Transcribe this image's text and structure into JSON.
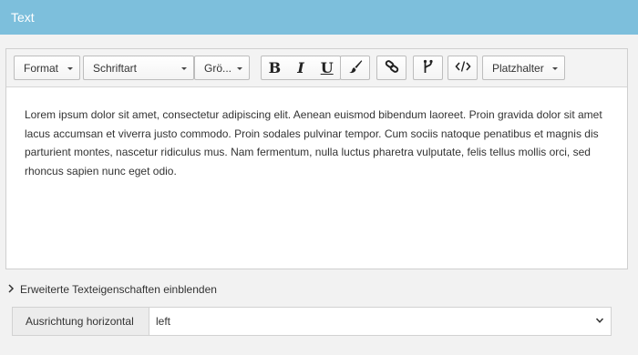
{
  "header": {
    "title": "Text"
  },
  "toolbar": {
    "format_label": "Format",
    "font_label": "Schriftart",
    "size_label": "Grö...",
    "bold_label": "B",
    "italic_label": "I",
    "underline_label": "U",
    "placeholder_label": "Platzhalter",
    "icons": [
      "brush-icon",
      "link-icon",
      "fork-icon",
      "code-icon"
    ]
  },
  "content": {
    "text": "Lorem ipsum dolor sit amet, consectetur adipiscing elit. Aenean euismod bibendum laoreet. Proin gravida dolor sit amet lacus accumsan et viverra justo commodo. Proin sodales pulvinar tempor. Cum sociis natoque penatibus et magnis dis parturient montes, nascetur ridiculus mus. Nam fermentum, nulla luctus pharetra vulputate, felis tellus mollis orci, sed rhoncus sapien nunc eget odio."
  },
  "advanced": {
    "label": "Erweiterte Texteigenschaften einblenden"
  },
  "alignment": {
    "label": "Ausrichtung horizontal",
    "value": "left"
  },
  "colors": {
    "header_bg": "#7dbfdc",
    "header_text": "#ffffff"
  }
}
